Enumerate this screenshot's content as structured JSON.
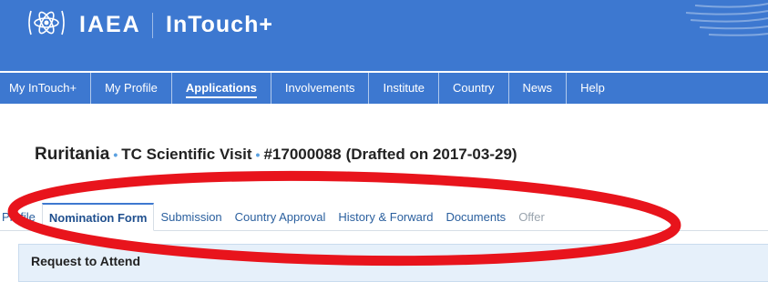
{
  "header": {
    "org": "IAEA",
    "app_title": "InTouch+"
  },
  "nav": {
    "items": [
      {
        "label": "My InTouch+"
      },
      {
        "label": "My Profile"
      },
      {
        "label": "Applications",
        "active": true
      },
      {
        "label": "Involvements"
      },
      {
        "label": "Institute"
      },
      {
        "label": "Country"
      },
      {
        "label": "News"
      },
      {
        "label": "Help"
      }
    ]
  },
  "page": {
    "country": "Ruritania",
    "type": "TC Scientific Visit",
    "id": "#17000088",
    "drafted": "(Drafted on 2017-03-29)"
  },
  "tabs": [
    {
      "label": "Profile"
    },
    {
      "label": "Nomination Form",
      "active": true
    },
    {
      "label": "Submission"
    },
    {
      "label": "Country Approval"
    },
    {
      "label": "History & Forward"
    },
    {
      "label": "Documents"
    },
    {
      "label": "Offer",
      "disabled": true
    }
  ],
  "panel": {
    "title": "Request to Attend"
  },
  "colors": {
    "header_blue": "#3d78d0",
    "annotation_red": "#e8141c",
    "tab_link": "#2a5f9e"
  },
  "icons": {
    "logo": "atom-emblem-icon"
  }
}
